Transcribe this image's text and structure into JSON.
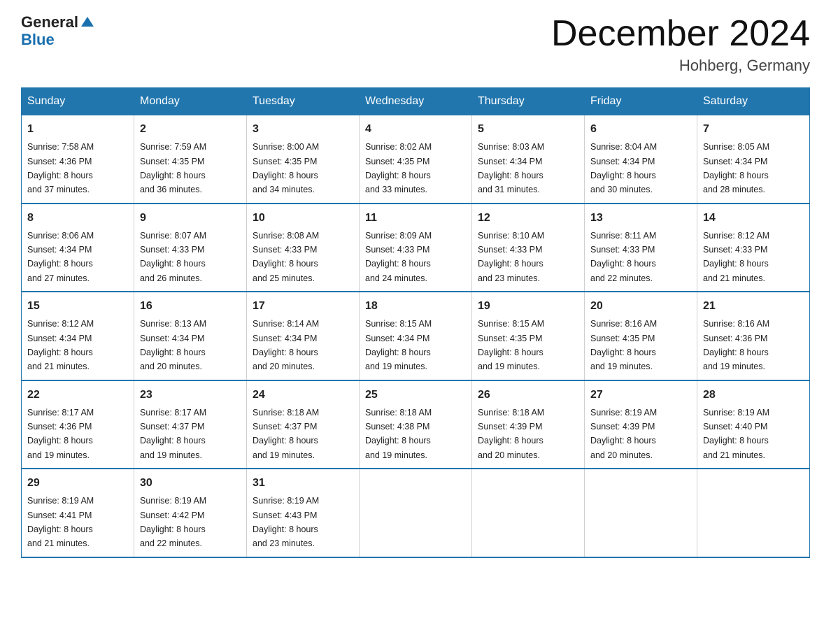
{
  "logo": {
    "line1": "General",
    "arrow": "▶",
    "line2": "Blue"
  },
  "title": "December 2024",
  "location": "Hohberg, Germany",
  "days_header": [
    "Sunday",
    "Monday",
    "Tuesday",
    "Wednesday",
    "Thursday",
    "Friday",
    "Saturday"
  ],
  "weeks": [
    [
      {
        "day": "1",
        "sunrise": "7:58 AM",
        "sunset": "4:36 PM",
        "daylight": "8 hours and 37 minutes."
      },
      {
        "day": "2",
        "sunrise": "7:59 AM",
        "sunset": "4:35 PM",
        "daylight": "8 hours and 36 minutes."
      },
      {
        "day": "3",
        "sunrise": "8:00 AM",
        "sunset": "4:35 PM",
        "daylight": "8 hours and 34 minutes."
      },
      {
        "day": "4",
        "sunrise": "8:02 AM",
        "sunset": "4:35 PM",
        "daylight": "8 hours and 33 minutes."
      },
      {
        "day": "5",
        "sunrise": "8:03 AM",
        "sunset": "4:34 PM",
        "daylight": "8 hours and 31 minutes."
      },
      {
        "day": "6",
        "sunrise": "8:04 AM",
        "sunset": "4:34 PM",
        "daylight": "8 hours and 30 minutes."
      },
      {
        "day": "7",
        "sunrise": "8:05 AM",
        "sunset": "4:34 PM",
        "daylight": "8 hours and 28 minutes."
      }
    ],
    [
      {
        "day": "8",
        "sunrise": "8:06 AM",
        "sunset": "4:34 PM",
        "daylight": "8 hours and 27 minutes."
      },
      {
        "day": "9",
        "sunrise": "8:07 AM",
        "sunset": "4:33 PM",
        "daylight": "8 hours and 26 minutes."
      },
      {
        "day": "10",
        "sunrise": "8:08 AM",
        "sunset": "4:33 PM",
        "daylight": "8 hours and 25 minutes."
      },
      {
        "day": "11",
        "sunrise": "8:09 AM",
        "sunset": "4:33 PM",
        "daylight": "8 hours and 24 minutes."
      },
      {
        "day": "12",
        "sunrise": "8:10 AM",
        "sunset": "4:33 PM",
        "daylight": "8 hours and 23 minutes."
      },
      {
        "day": "13",
        "sunrise": "8:11 AM",
        "sunset": "4:33 PM",
        "daylight": "8 hours and 22 minutes."
      },
      {
        "day": "14",
        "sunrise": "8:12 AM",
        "sunset": "4:33 PM",
        "daylight": "8 hours and 21 minutes."
      }
    ],
    [
      {
        "day": "15",
        "sunrise": "8:12 AM",
        "sunset": "4:34 PM",
        "daylight": "8 hours and 21 minutes."
      },
      {
        "day": "16",
        "sunrise": "8:13 AM",
        "sunset": "4:34 PM",
        "daylight": "8 hours and 20 minutes."
      },
      {
        "day": "17",
        "sunrise": "8:14 AM",
        "sunset": "4:34 PM",
        "daylight": "8 hours and 20 minutes."
      },
      {
        "day": "18",
        "sunrise": "8:15 AM",
        "sunset": "4:34 PM",
        "daylight": "8 hours and 19 minutes."
      },
      {
        "day": "19",
        "sunrise": "8:15 AM",
        "sunset": "4:35 PM",
        "daylight": "8 hours and 19 minutes."
      },
      {
        "day": "20",
        "sunrise": "8:16 AM",
        "sunset": "4:35 PM",
        "daylight": "8 hours and 19 minutes."
      },
      {
        "day": "21",
        "sunrise": "8:16 AM",
        "sunset": "4:36 PM",
        "daylight": "8 hours and 19 minutes."
      }
    ],
    [
      {
        "day": "22",
        "sunrise": "8:17 AM",
        "sunset": "4:36 PM",
        "daylight": "8 hours and 19 minutes."
      },
      {
        "day": "23",
        "sunrise": "8:17 AM",
        "sunset": "4:37 PM",
        "daylight": "8 hours and 19 minutes."
      },
      {
        "day": "24",
        "sunrise": "8:18 AM",
        "sunset": "4:37 PM",
        "daylight": "8 hours and 19 minutes."
      },
      {
        "day": "25",
        "sunrise": "8:18 AM",
        "sunset": "4:38 PM",
        "daylight": "8 hours and 19 minutes."
      },
      {
        "day": "26",
        "sunrise": "8:18 AM",
        "sunset": "4:39 PM",
        "daylight": "8 hours and 20 minutes."
      },
      {
        "day": "27",
        "sunrise": "8:19 AM",
        "sunset": "4:39 PM",
        "daylight": "8 hours and 20 minutes."
      },
      {
        "day": "28",
        "sunrise": "8:19 AM",
        "sunset": "4:40 PM",
        "daylight": "8 hours and 21 minutes."
      }
    ],
    [
      {
        "day": "29",
        "sunrise": "8:19 AM",
        "sunset": "4:41 PM",
        "daylight": "8 hours and 21 minutes."
      },
      {
        "day": "30",
        "sunrise": "8:19 AM",
        "sunset": "4:42 PM",
        "daylight": "8 hours and 22 minutes."
      },
      {
        "day": "31",
        "sunrise": "8:19 AM",
        "sunset": "4:43 PM",
        "daylight": "8 hours and 23 minutes."
      },
      null,
      null,
      null,
      null
    ]
  ],
  "labels": {
    "sunrise": "Sunrise:",
    "sunset": "Sunset:",
    "daylight": "Daylight:"
  }
}
